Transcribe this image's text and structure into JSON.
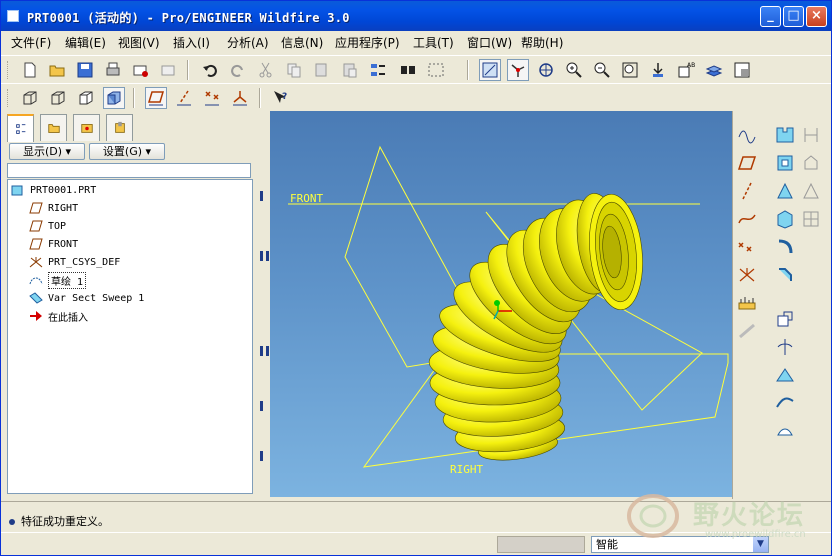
{
  "window": {
    "title": "PRT0001 (活动的) - Pro/ENGINEER Wildfire 3.0",
    "controls": {
      "minimize": "_",
      "maximize": "□",
      "close": "×"
    }
  },
  "menubar": {
    "items": [
      {
        "label": "文件(F)"
      },
      {
        "label": "编辑(E)"
      },
      {
        "label": "视图(V)"
      },
      {
        "label": "插入(I)"
      },
      {
        "label": "分析(A)"
      },
      {
        "label": "信息(N)"
      },
      {
        "label": "应用程序(P)"
      },
      {
        "label": "工具(T)"
      },
      {
        "label": "窗口(W)"
      },
      {
        "label": "帮助(H)"
      }
    ]
  },
  "toolbar1": {
    "icons": [
      "new-icon",
      "open-icon",
      "save-icon",
      "print-icon",
      "send-mail-icon",
      "mail-attach-icon",
      "undo-icon",
      "redo-icon",
      "cut-icon",
      "copy-icon",
      "paste-icon",
      "paste-special-icon",
      "regenerate-icon",
      "find-icon",
      "select-box-icon",
      "repaint-icon",
      "spin-center-icon",
      "orient-mode-icon",
      "zoom-in-icon",
      "zoom-out-icon",
      "refit-icon",
      "reorient-icon",
      "saved-views-icon",
      "layers-icon",
      "view-manager-icon"
    ]
  },
  "toolbar2": {
    "icons": [
      "wireframe-icon",
      "hidden-line-icon",
      "no-hidden-icon",
      "shading-icon",
      "datum-planes-icon",
      "datum-axes-icon",
      "datum-points-icon",
      "coord-sys-icon",
      "context-help-icon"
    ]
  },
  "navigator": {
    "tabs": [
      "model-tree-icon",
      "folder-browser-icon",
      "favorites-icon",
      "connections-icon"
    ],
    "show_button": "显示(D)",
    "settings_button": "设置(G)",
    "tree": [
      {
        "label": "PRT0001.PRT",
        "icon": "part-icon"
      },
      {
        "label": "RIGHT",
        "icon": "datum-plane-icon"
      },
      {
        "label": "TOP",
        "icon": "datum-plane-icon"
      },
      {
        "label": "FRONT",
        "icon": "datum-plane-icon"
      },
      {
        "label": "PRT_CSYS_DEF",
        "icon": "csys-icon"
      },
      {
        "label": "草绘 1",
        "icon": "sketch-icon"
      },
      {
        "label": "Var Sect Sweep 1",
        "icon": "sweep-icon"
      },
      {
        "label": "在此插入",
        "icon": "insert-here-arrow-icon"
      }
    ]
  },
  "viewport": {
    "datum_labels": {
      "front": "FRONT",
      "right": "RIGHT"
    },
    "model_color": "#f5f10f",
    "datum_color": "#ffff3c"
  },
  "right_toolbar": {
    "icons": [
      "datum-curve-sketch-icon",
      "datum-plane-tool-icon",
      "datum-axis-tool-icon",
      "datum-curve-icon",
      "datum-point-icon",
      "coord-sys-tool-icon",
      "analysis-feature-icon",
      "extrude-icon",
      "revolve-icon",
      "var-sweep-icon",
      "blend-icon",
      "style-icon",
      "hole-icon",
      "shell-icon",
      "rib-icon",
      "draft-icon",
      "round-icon",
      "chamfer-icon",
      "pattern-icon",
      "mirror-icon",
      "merge-icon",
      "trim-icon",
      "offset-icon",
      "thicken-icon"
    ]
  },
  "status": {
    "message": "特征成功重定义。",
    "filter_value": "智能"
  },
  "watermark": {
    "text": "野火论坛",
    "url": "www.proewildfire.cn"
  }
}
